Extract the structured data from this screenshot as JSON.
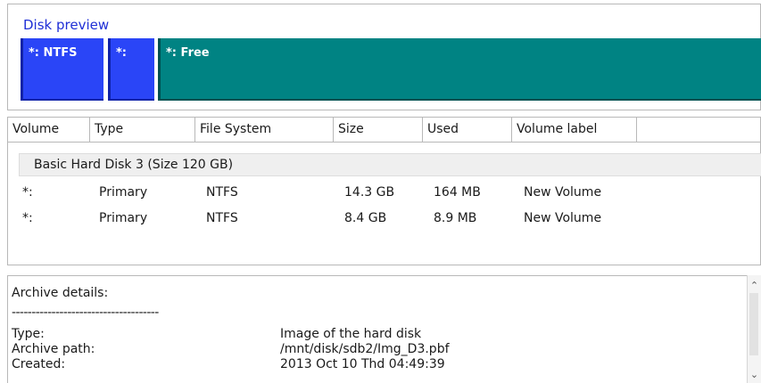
{
  "disk_preview": {
    "title": "Disk preview",
    "partitions": [
      {
        "label": "*: NTFS",
        "kind": "ntfs",
        "color": "#2a45f7"
      },
      {
        "label": "*:",
        "kind": "ntfs",
        "color": "#2a45f7"
      },
      {
        "label": "*: Free",
        "kind": "free",
        "color": "#008383"
      }
    ]
  },
  "volumes": {
    "columns": [
      "Volume",
      "Type",
      "File System",
      "Size",
      "Used",
      "Volume label"
    ],
    "group_label": "Basic Hard Disk 3 (Size 120 GB)",
    "rows": [
      {
        "volume": "*:",
        "type": "Primary",
        "fs": "NTFS",
        "size": "14.3 GB",
        "used": "164 MB",
        "label": "New Volume"
      },
      {
        "volume": "*:",
        "type": "Primary",
        "fs": "NTFS",
        "size": "8.4 GB",
        "used": "8.9 MB",
        "label": "New Volume"
      }
    ]
  },
  "archive_details": {
    "heading": "Archive details:",
    "separator": "-------------------------------------",
    "fields": [
      {
        "key": "Type:",
        "value": "Image of the hard disk"
      },
      {
        "key": "Archive path:",
        "value": "/mnt/disk/sdb2/Img_D3.pbf"
      },
      {
        "key": "Created:",
        "value": "2013 Oct 10 Thd 04:49:39"
      }
    ]
  },
  "scrollbar": {
    "up_icon": "chevron-up-icon",
    "down_icon": "chevron-down-icon"
  }
}
